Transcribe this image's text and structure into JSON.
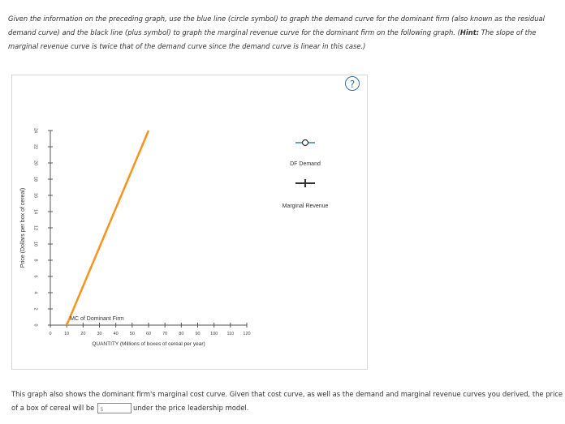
{
  "question": {
    "part1": "Given the information on the preceding graph, use the blue line (circle symbol) to graph the demand curve for the dominant firm (also known as the residual demand curve) and the black line (plus symbol) to graph the marginal revenue curve for the dominant firm on the following graph. (",
    "hint_label": "Hint:",
    "part2": " The slope of the marginal revenue curve is twice that of the demand curve since the demand curve is linear in this case.)"
  },
  "help_icon": "?",
  "chart_data": {
    "type": "line",
    "xlabel": "QUANTITY (Millions of boxes of cereal per year)",
    "ylabel": "Price (Dollars per box of cereal)",
    "xlim": [
      0,
      120
    ],
    "ylim": [
      0,
      24
    ],
    "xticks": [
      0,
      10,
      20,
      30,
      40,
      50,
      60,
      70,
      80,
      90,
      100,
      110,
      120
    ],
    "yticks": [
      0,
      2,
      4,
      6,
      8,
      10,
      12,
      14,
      16,
      18,
      20,
      22,
      24
    ],
    "series": [
      {
        "name": "MC of Dominant Firm",
        "color": "#f7941d",
        "x": [
          10,
          60
        ],
        "y": [
          0,
          24
        ]
      }
    ]
  },
  "tools": [
    {
      "label": "DF Demand",
      "icon": "circle-marker-icon",
      "color": "#6f9ccf"
    },
    {
      "label": "Marginal Revenue",
      "icon": "plus-marker-icon",
      "color": "#333333"
    }
  ],
  "bottom": {
    "text1": "This graph also shows the dominant firm's marginal cost curve. Given that cost curve, as well as the demand and marginal revenue curves you derived, the price of a box of cereal will be",
    "currency": "$",
    "answer_value": "",
    "text2": "under the price leadership model."
  }
}
